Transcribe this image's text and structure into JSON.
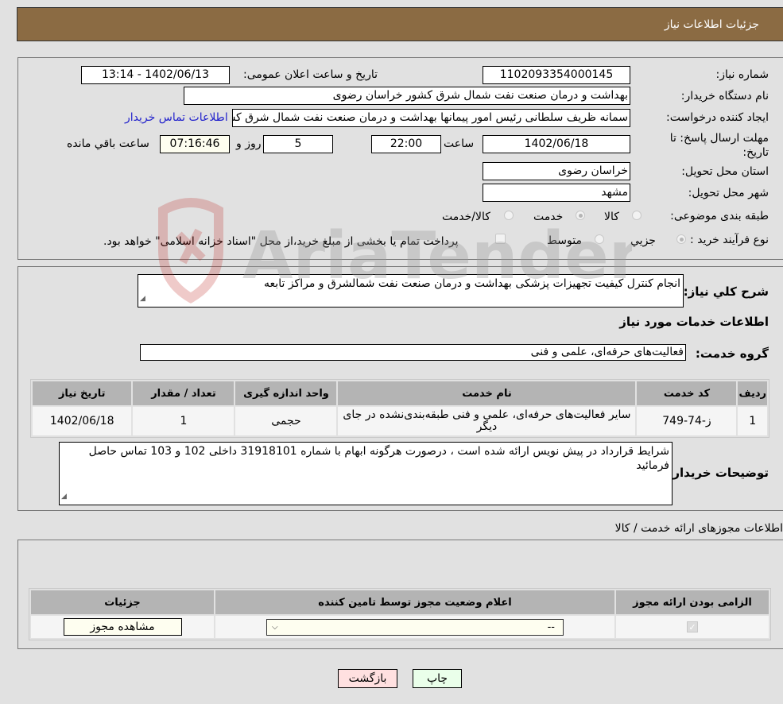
{
  "header": {
    "title": "جزئیات اطلاعات نیاز"
  },
  "form": {
    "need_number": {
      "label": "شماره نیاز:",
      "value": "1102093354000145"
    },
    "announce_datetime": {
      "label": "تاریخ و ساعت اعلان عمومی:",
      "value": "1402/06/13 - 13:14"
    },
    "buyer_org": {
      "label": "نام دستگاه خریدار:",
      "value": "بهداشت و درمان صنعت نفت شمال شرق کشور   خراسان رضوی"
    },
    "requester": {
      "label": "ایجاد کننده درخواست:",
      "value": "سمانه ظریف سلطانی رئیس امور پیمانها بهداشت و درمان صنعت نفت شمال شرق کشور"
    },
    "buyer_contact_link": "اطلاعات تماس خریدار",
    "deadline": {
      "label": "مهلت ارسال پاسخ: تا تاریخ:",
      "date": "1402/06/18",
      "time_label": "ساعت",
      "time": "22:00",
      "days": "5",
      "days_label": "روز و",
      "remaining": "07:16:46",
      "remaining_label": "ساعت باقي مانده"
    },
    "delivery_province": {
      "label": "استان محل تحویل:",
      "value": "خراسان رضوی"
    },
    "delivery_city": {
      "label": "شهر محل تحویل:",
      "value": "مشهد"
    },
    "category": {
      "label": "طبقه بندی موضوعی:",
      "options": [
        "کالا",
        "خدمت",
        "کالا/خدمت"
      ],
      "selected": "خدمت"
    },
    "purchase_type": {
      "label": "نوع فرآیند خرید :",
      "options": [
        "جزيي",
        "متوسط"
      ],
      "selected": "جزيي",
      "treasury_note": "پرداخت تمام یا بخشی از مبلغ خرید،از محل \"اسناد خزانه اسلامی\" خواهد بود."
    }
  },
  "summary": {
    "label": "شرح کلي نياز:",
    "value": "انجام کنترل کیفیت تجهیزات پزشکی بهداشت و درمان صنعت نفت شمالشرق و مراکز تابعه"
  },
  "services": {
    "section_title": "اطلاعات خدمات مورد نیاز",
    "group_label": "گروه خدمت:",
    "group_value": "فعالیت‌های حرفه‌ای، علمی و فنی",
    "columns": [
      "ردیف",
      "کد خدمت",
      "نام خدمت",
      "واحد اندازه گیری",
      "تعداد / مقدار",
      "تاریخ نیاز"
    ],
    "rows": [
      [
        "1",
        "ز-74-749",
        "سایر فعالیت‌های حرفه‌ای، علمی و فنی طبقه‌بندی‌نشده در جای دیگر",
        "حجمی",
        "1",
        "1402/06/18"
      ]
    ]
  },
  "buyer_notes": {
    "label": "توضیحات خریدار:",
    "value": "شرایط قرارداد در پیش نویس ارائه شده است ، درصورت هرگونه ابهام با شماره 31918101 داخلی 102 و 103 تماس حاصل فرمائید"
  },
  "permits": {
    "section_title": "اطلاعات مجوزهای ارائه خدمت / کالا",
    "columns": [
      "الزامی بودن ارائه مجوز",
      "اعلام وضعیت مجوز توسط تامین کننده",
      "جزئیات"
    ],
    "row": {
      "required_checked": true,
      "status_value": "--",
      "details_button": "مشاهده مجوز"
    }
  },
  "buttons": {
    "print": "چاپ",
    "back": "بازگشت"
  },
  "watermark": {
    "text": "AriaTender.neT"
  },
  "colors": {
    "header": "#8b6b43",
    "link": "#2222cc",
    "back_btn": "#ffe0e0",
    "print_btn": "#eaffea"
  }
}
